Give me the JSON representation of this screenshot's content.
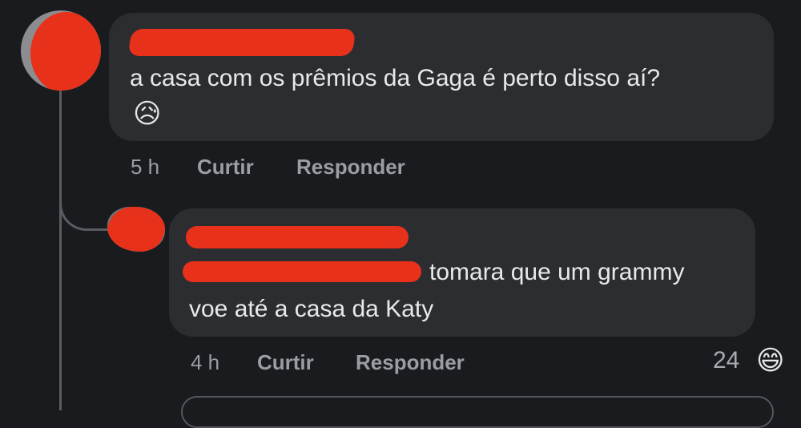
{
  "comments": [
    {
      "author": "",
      "text": "a casa com os prêmios da Gaga é perto disso aí?",
      "emoji": "😥",
      "emoji_icon": "sad-relieved-face-icon",
      "time": "5 h",
      "like_label": "Curtir",
      "reply_label": "Responder"
    },
    {
      "author": "",
      "mention": "",
      "text_line1": "tomara que um grammy",
      "text_line2": "voe até a casa da Katy",
      "time": "4 h",
      "like_label": "Curtir",
      "reply_label": "Responder",
      "reaction_count": "24",
      "reaction_emoji": "😄",
      "reaction_icon": "laughing-face-icon"
    }
  ],
  "colors": {
    "background": "#1a1b1e",
    "bubble": "#2c2d31",
    "text": "#e8e9ec",
    "meta": "#9b9da2",
    "redaction": "#e8311a"
  }
}
